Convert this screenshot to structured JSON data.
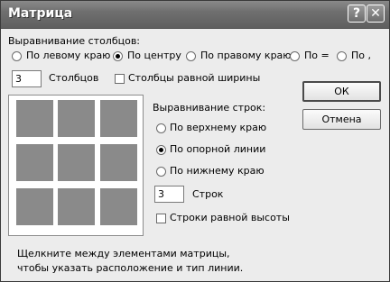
{
  "window": {
    "title": "Матрица"
  },
  "titlebar": {
    "help_glyph": "?",
    "close_glyph": "✕"
  },
  "columns": {
    "heading": "Выравнивание столбцов:",
    "options": [
      "По левому краю",
      "По центру",
      "По правому краю",
      "По =",
      "По ,"
    ],
    "selected": "По центру",
    "count": "3",
    "count_label": "Столбцов",
    "equal_width_label": "Столбцы равной ширины",
    "equal_width_checked": false
  },
  "rows": {
    "heading": "Выравнивание строк:",
    "options": [
      "По верхнему краю",
      "По опорной линии",
      "По нижнему краю"
    ],
    "selected": "По опорной линии",
    "count": "3",
    "count_label": "Строк",
    "equal_height_label": "Строки равной высоты",
    "equal_height_checked": false
  },
  "buttons": {
    "ok": "ОК",
    "cancel": "Отмена"
  },
  "hint": {
    "line1": "Щелкните между элементами матрицы,",
    "line2": "чтобы указать расположение и тип линии."
  },
  "matrix": {
    "rows": 3,
    "cols": 3
  }
}
